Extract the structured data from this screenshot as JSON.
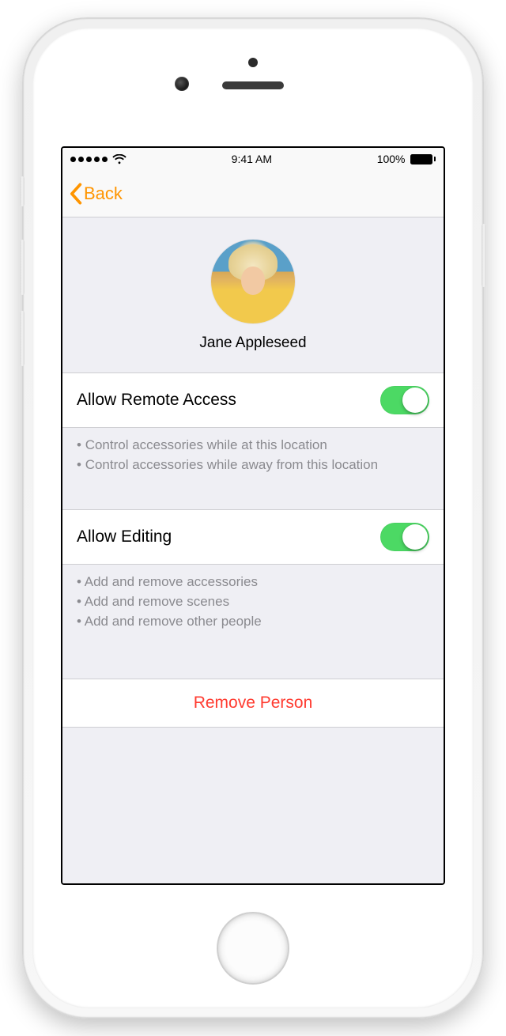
{
  "status_bar": {
    "time": "9:41 AM",
    "battery_pct": "100%"
  },
  "nav": {
    "back_label": "Back"
  },
  "profile": {
    "name": "Jane Appleseed"
  },
  "sections": {
    "remote_access": {
      "title": "Allow Remote Access",
      "enabled": true,
      "bullets": [
        "Control accessories while at this location",
        "Control accessories while away from this location"
      ]
    },
    "editing": {
      "title": "Allow Editing",
      "enabled": true,
      "bullets": [
        "Add and remove accessories",
        "Add and remove scenes",
        "Add and remove other people"
      ]
    }
  },
  "remove_label": "Remove Person"
}
